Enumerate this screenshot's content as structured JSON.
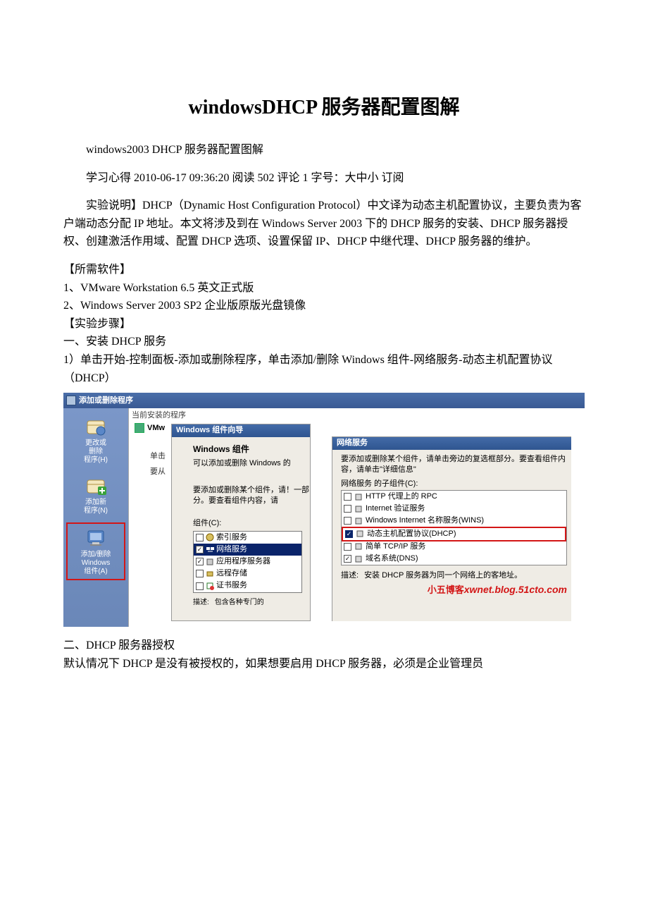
{
  "title": "windowsDHCP 服务器配置图解",
  "intro": {
    "line1": "windows2003 DHCP 服务器配置图解",
    "line2": "学习心得 2010-06-17 09:36:20 阅读 502 评论 1  字号：大中小 订阅",
    "body": "实验说明】DHCP（Dynamic Host Configuration Protocol）中文译为动态主机配置协议，主要负责为客户端动态分配 IP 地址。本文将涉及到在 Windows Server 2003 下的 DHCP 服务的安装、DHCP 服务器授权、创建激活作用域、配置 DHCP 选项、设置保留 IP、DHCP 中继代理、DHCP 服务器的维护。"
  },
  "software": {
    "heading": "【所需软件】",
    "item1": "1、VMware Workstation 6.5 英文正式版",
    "item2": "2、Windows Server 2003 SP2 企业版原版光盘镜像"
  },
  "steps": {
    "heading": "【实验步骤】",
    "s1": "一、安装 DHCP 服务",
    "s1_1": "1）单击开始-控制面板-添加或删除程序，单击添加/删除 Windows 组件-网络服务-动态主机配置协议（DHCP）"
  },
  "screenshot": {
    "titlebar": "添加或删除程序",
    "sidebar": {
      "item1": {
        "l1": "更改或",
        "l2": "删除",
        "l3": "程序(H)"
      },
      "item2": {
        "l1": "添加新",
        "l2": "程序(N)"
      },
      "item3": {
        "l1": "添加/删除",
        "l2": "Windows",
        "l3": "组件(A)"
      }
    },
    "current": "当前安装的程序",
    "vmw": "VMw",
    "btn1": "单击",
    "btn2": "要从",
    "wizard": {
      "title": "Windows 组件向导",
      "heading": "Windows 组件",
      "sub": "可以添加或删除 Windows 的",
      "hint": "要添加或删除某个组件，请！一部分。要查看组件内容，请",
      "list_label": "组件(C):",
      "items": {
        "i1": "索引服务",
        "i2": "网络服务",
        "i3": "应用程序服务器",
        "i4": "远程存储",
        "i5": "证书服务"
      },
      "desc_label": "描述:",
      "desc_text": "包含各种专门的"
    },
    "svc": {
      "title": "网络服务",
      "hint": "要添加或删除某个组件，请单击旁边的复选框部分。要查看组件内容，请单击\"详细信息\"",
      "list_label": "网络服务 的子组件(C):",
      "items": {
        "i1": "HTTP 代理上的 RPC",
        "i2": "Internet 验证服务",
        "i3": "Windows Internet 名称服务(WINS)",
        "i4": "动态主机配置协议(DHCP)",
        "i5": "简单 TCP/IP 服务",
        "i6": "域名系统(DNS)"
      },
      "desc_label": "描述:",
      "desc_text": "安装 DHCP 服务器为同一个网络上的客地址。"
    },
    "watermark": {
      "cn": "小五博客",
      "en": "xwnet.blog.51cto.com"
    }
  },
  "after": {
    "s2": "二、DHCP 服务器授权",
    "s2_1": "默认情况下 DHCP 是没有被授权的，如果想要启用 DHCP 服务器，必须是企业管理员"
  }
}
